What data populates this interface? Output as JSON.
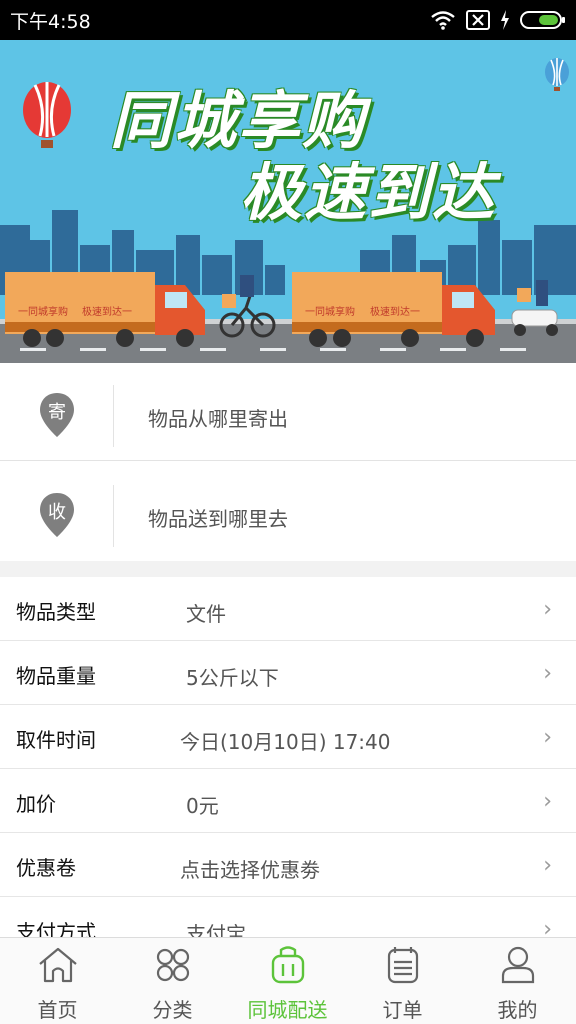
{
  "status_bar": {
    "time": "下午4:58",
    "icons": [
      "wifi-icon",
      "no-sim-icon",
      "charging-icon",
      "battery-icon"
    ]
  },
  "banner": {
    "headline_line1": "同城享购",
    "headline_line2": "极速到达",
    "truck_text_left": "一同城享购",
    "truck_text_right": "极速到达一"
  },
  "address": {
    "sender_badge": "寄",
    "sender_placeholder": "物品从哪里寄出",
    "receiver_badge": "收",
    "receiver_placeholder": "物品送到哪里去"
  },
  "form": {
    "rows": [
      {
        "label": "物品类型",
        "value": "文件"
      },
      {
        "label": "物品重量",
        "value": "5公斤以下"
      },
      {
        "label": "取件时间",
        "value": "今日(10月10日) 17:40"
      },
      {
        "label": "加价",
        "value": "0元"
      },
      {
        "label": "优惠卷",
        "value": "点击选择优惠劵"
      },
      {
        "label": "支付方式",
        "value": "支付宝"
      }
    ],
    "chevron": "›"
  },
  "tabs": [
    {
      "label": "首页",
      "icon": "home-icon"
    },
    {
      "label": "分类",
      "icon": "category-icon"
    },
    {
      "label": "同城配送",
      "icon": "delivery-bag-icon"
    },
    {
      "label": "订单",
      "icon": "order-list-icon"
    },
    {
      "label": "我的",
      "icon": "user-icon"
    }
  ],
  "colors": {
    "accent": "#5cc33a",
    "banner_sky": "#5ec4e6",
    "pin_gray": "#7f7f7f",
    "tab_inactive": "#555555"
  },
  "active_tab_index": 2
}
